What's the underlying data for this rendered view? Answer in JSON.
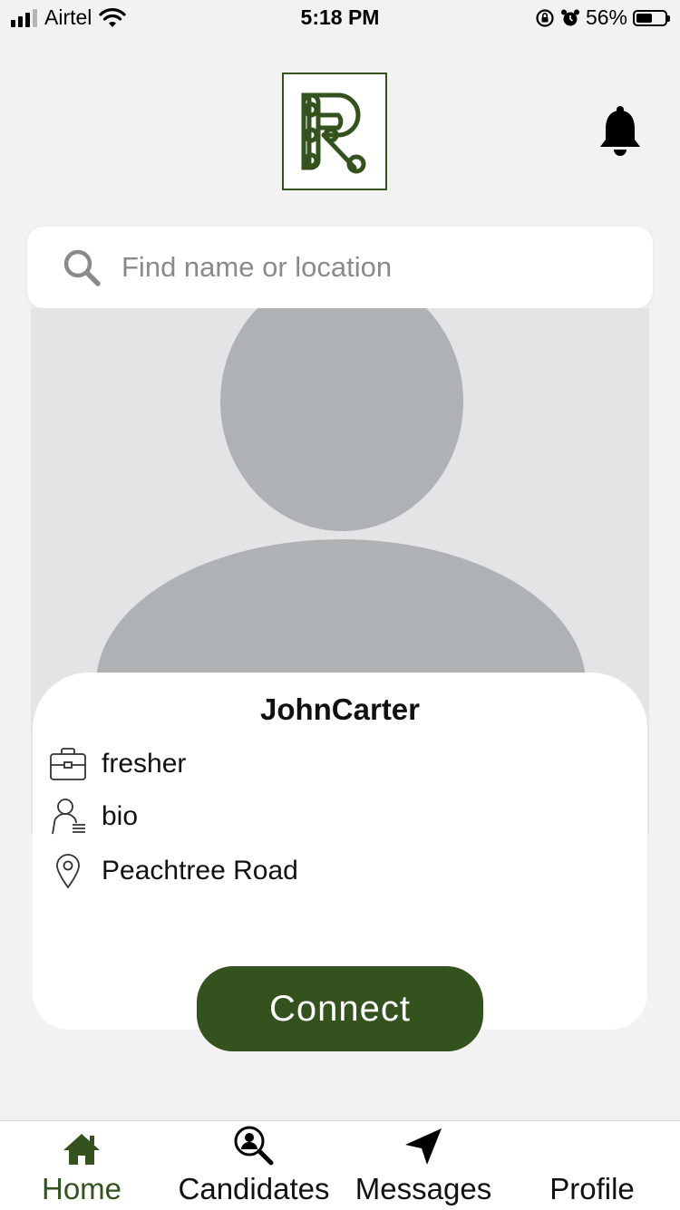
{
  "status_bar": {
    "carrier": "Airtel",
    "time": "5:18 PM",
    "battery_percent": "56%",
    "battery_level": 0.56,
    "icons": [
      "signal-icon",
      "wifi-icon",
      "orientation-lock-icon",
      "alarm-icon",
      "battery-icon"
    ]
  },
  "header": {
    "logo_letter": "R",
    "notification_icon": "bell-icon"
  },
  "search": {
    "placeholder": "Find name or location",
    "value": "",
    "icon": "search-icon"
  },
  "profile": {
    "name": "JohnCarter",
    "experience": "fresher",
    "bio": "bio",
    "location": "Peachtree Road",
    "connect_label": "Connect"
  },
  "tabs": [
    {
      "label": "Home",
      "icon": "home-icon",
      "active": true
    },
    {
      "label": "Candidates",
      "icon": "candidates-search-icon",
      "active": false
    },
    {
      "label": "Messages",
      "icon": "send-icon",
      "active": false
    },
    {
      "label": "Profile",
      "icon": "profile-icon",
      "active": false
    }
  ],
  "colors": {
    "accent": "#33521e",
    "background": "#f2f2f2",
    "avatar_placeholder": "#afb2b5"
  }
}
